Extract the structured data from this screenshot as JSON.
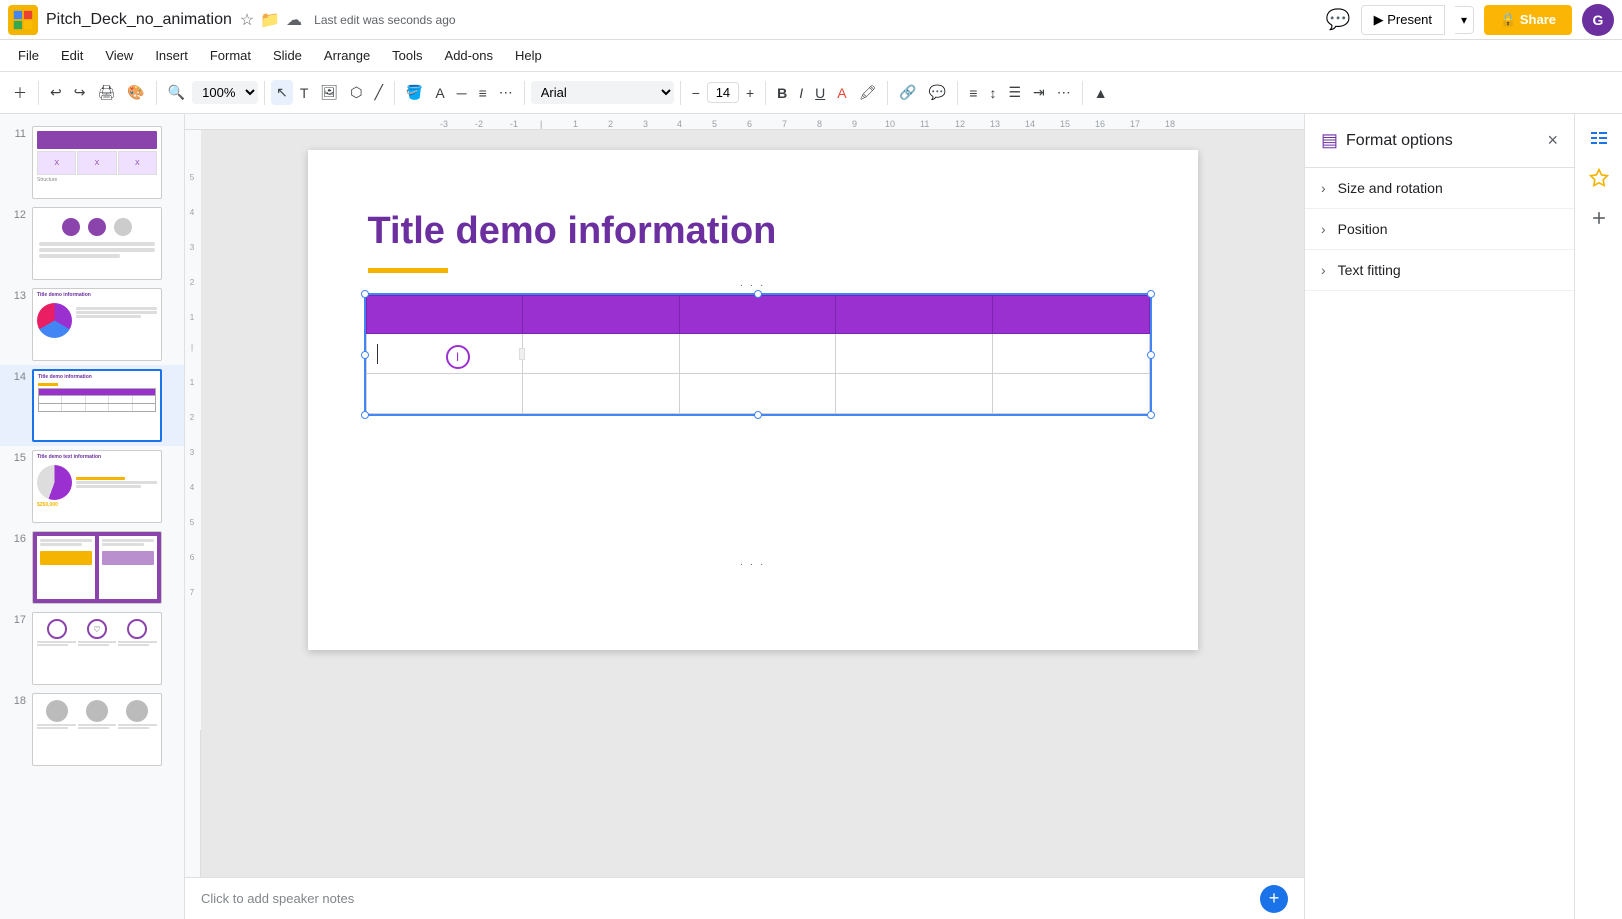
{
  "app": {
    "logo": "G",
    "doc_title": "Pitch_Deck_no_animation",
    "last_edit": "Last edit was seconds ago"
  },
  "menu": {
    "items": [
      "File",
      "Edit",
      "View",
      "Insert",
      "Format",
      "Slide",
      "Arrange",
      "Tools",
      "Add-ons",
      "Help"
    ]
  },
  "toolbar": {
    "font": "Arial",
    "font_size": "14",
    "zoom": "100%"
  },
  "top_right": {
    "present_label": "Present",
    "share_label": "🔒 Share",
    "avatar_initials": "G"
  },
  "slides": [
    {
      "number": "11",
      "label": "slide-11"
    },
    {
      "number": "12",
      "label": "slide-12"
    },
    {
      "number": "13",
      "label": "slide-13"
    },
    {
      "number": "14",
      "label": "slide-14",
      "active": true
    },
    {
      "number": "15",
      "label": "slide-15"
    },
    {
      "number": "16",
      "label": "slide-16"
    },
    {
      "number": "17",
      "label": "slide-17"
    },
    {
      "number": "18",
      "label": "slide-18"
    }
  ],
  "canvas": {
    "slide_title": "Title demo information",
    "notes_placeholder": "Click to add speaker notes"
  },
  "format_panel": {
    "title": "Format options",
    "close_label": "×",
    "sections": [
      {
        "label": "Size and rotation"
      },
      {
        "label": "Position"
      },
      {
        "label": "Text fitting"
      }
    ]
  },
  "right_icons": [
    {
      "name": "format-options-icon",
      "symbol": "≡"
    },
    {
      "name": "explore-icon",
      "symbol": "★"
    },
    {
      "name": "add-comment-icon",
      "symbol": "+"
    }
  ]
}
